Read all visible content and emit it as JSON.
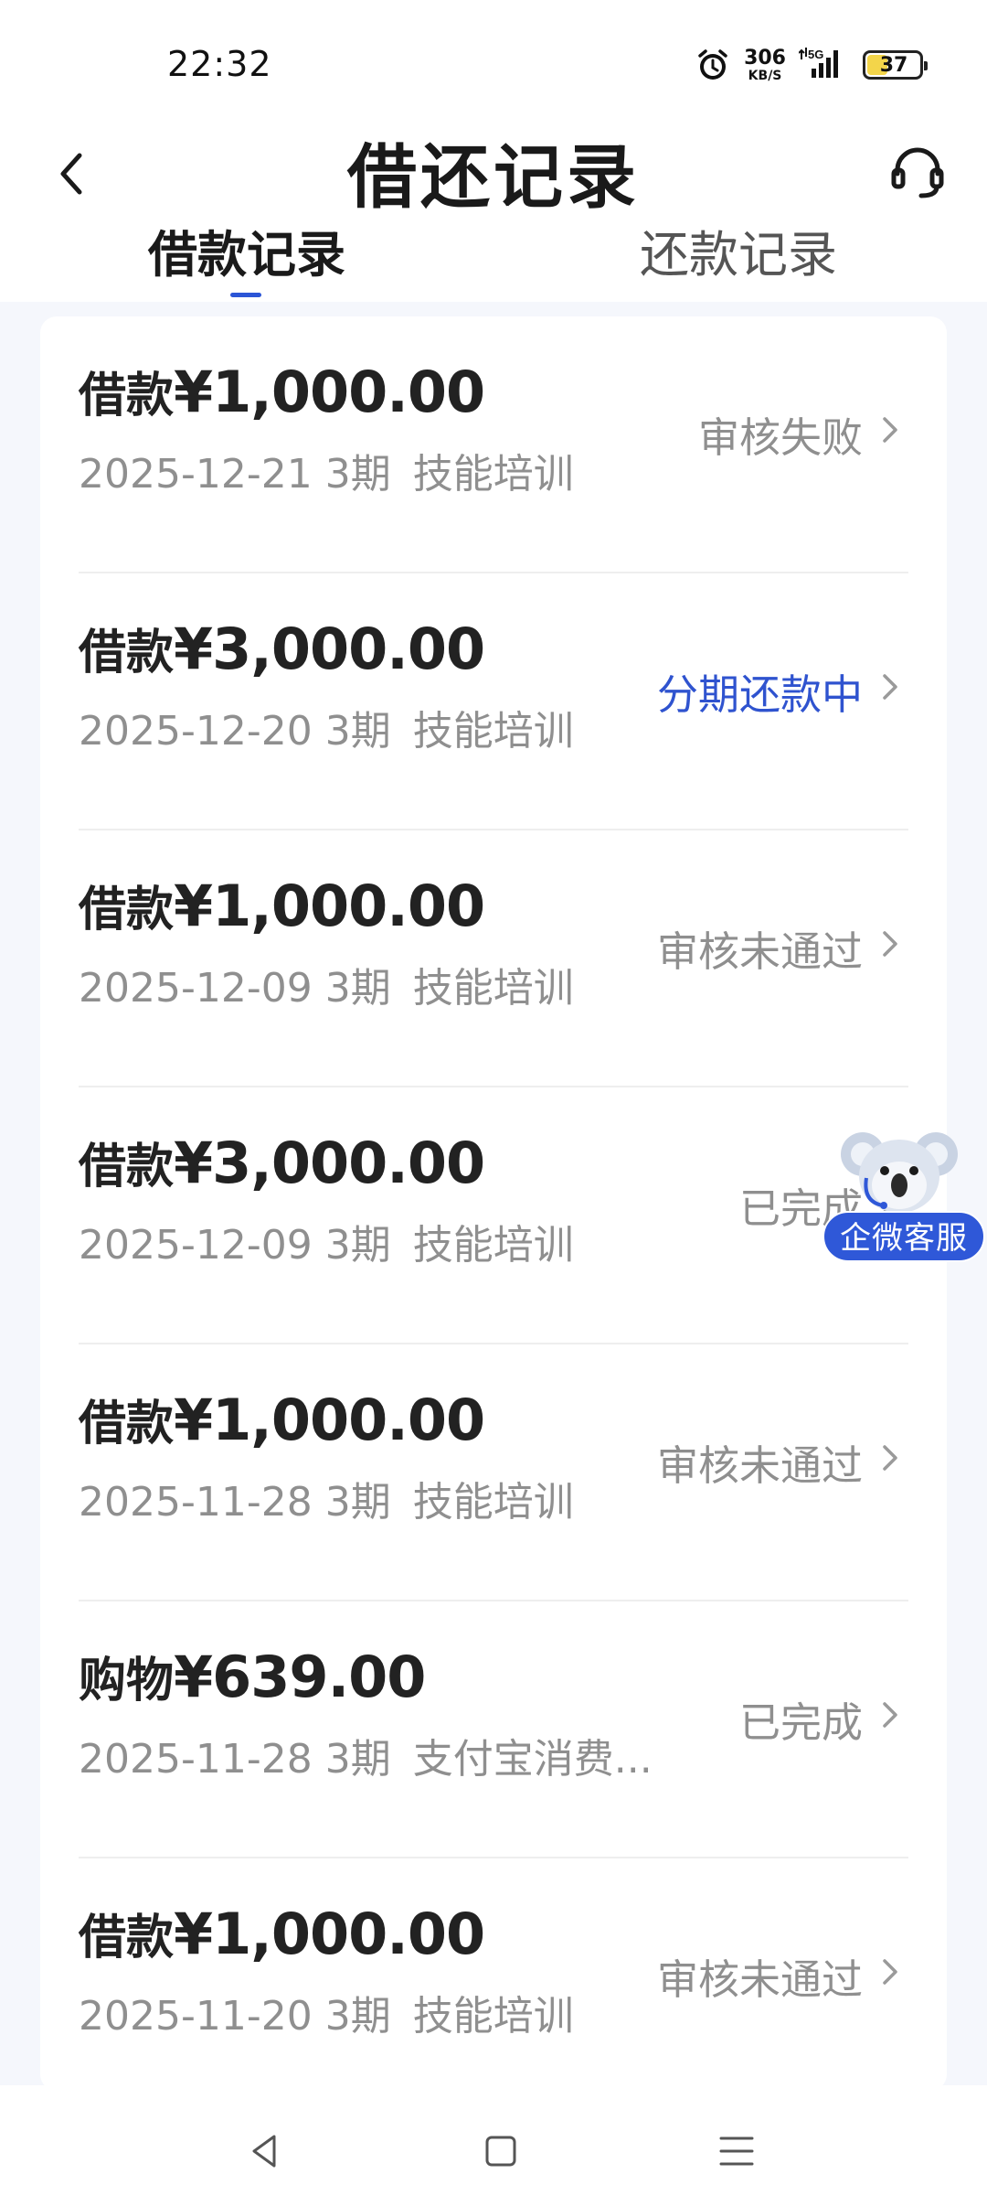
{
  "status_bar": {
    "time": "22:32",
    "net_speed_value": "306",
    "net_speed_unit": "KB/S",
    "network": "5G",
    "battery_level": "37",
    "icons": [
      "alarm-icon",
      "signal-icon",
      "battery-icon"
    ]
  },
  "header": {
    "title": "借还记录",
    "back_icon": "chevron-left-icon",
    "service_icon": "headset-icon"
  },
  "tabs": [
    {
      "label": "借款记录",
      "active": true
    },
    {
      "label": "还款记录",
      "active": false
    }
  ],
  "records": [
    {
      "type": "借款",
      "amount": "¥1,000.00",
      "date": "2025-12-21",
      "periods": "3期",
      "desc": "技能培训",
      "status": "审核失败",
      "status_color": "#8f8f8f"
    },
    {
      "type": "借款",
      "amount": "¥3,000.00",
      "date": "2025-12-20",
      "periods": "3期",
      "desc": "技能培训",
      "status": "分期还款中",
      "status_color": "#2f53cf"
    },
    {
      "type": "借款",
      "amount": "¥1,000.00",
      "date": "2025-12-09",
      "periods": "3期",
      "desc": "技能培训",
      "status": "审核未通过",
      "status_color": "#8f8f8f"
    },
    {
      "type": "借款",
      "amount": "¥3,000.00",
      "date": "2025-12-09",
      "periods": "3期",
      "desc": "技能培训",
      "status": "已完成",
      "status_color": "#8f8f8f"
    },
    {
      "type": "借款",
      "amount": "¥1,000.00",
      "date": "2025-11-28",
      "periods": "3期",
      "desc": "技能培训",
      "status": "审核未通过",
      "status_color": "#8f8f8f"
    },
    {
      "type": "购物",
      "amount": "¥639.00",
      "date": "2025-11-28",
      "periods": "3期",
      "desc": "支付宝消费...",
      "status": "已完成",
      "status_color": "#8f8f8f"
    },
    {
      "type": "借款",
      "amount": "¥1,000.00",
      "date": "2025-11-20",
      "periods": "3期",
      "desc": "技能培训",
      "status": "审核未通过",
      "status_color": "#8f8f8f"
    }
  ],
  "floating_service": {
    "label": "企微客服",
    "icon": "koala-mascot-icon"
  },
  "nav_bar": {
    "icons": [
      "nav-back-icon",
      "nav-home-icon",
      "nav-menu-icon"
    ]
  },
  "colors": {
    "accent": "#2f53cf",
    "muted": "#8f8f8f",
    "page_bg": "#f5f7fc"
  }
}
